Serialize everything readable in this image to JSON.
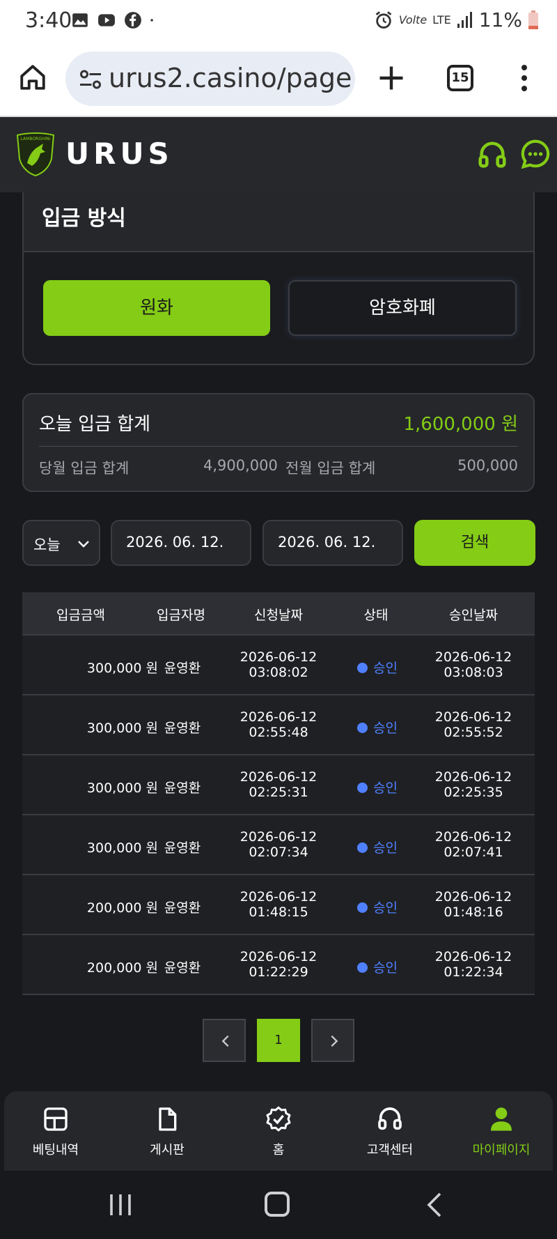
{
  "statusbar": {
    "time": "3:40",
    "battery": "11%",
    "network": "LTE"
  },
  "browser": {
    "url": "urus2.casino/page",
    "tab_count": "15"
  },
  "header": {
    "brand": "URUS",
    "logo_icon": "lamborghini-shield",
    "accent": "#84cc16"
  },
  "method": {
    "title": "입금 방식",
    "krw_label": "원화",
    "crypto_label": "암호화폐"
  },
  "totals": {
    "today_label": "오늘 입금 합계",
    "today_value": "1,600,000 원",
    "month_label": "당월 입금 합계",
    "month_value": "4,900,000",
    "prev_label": "전월 입금 합계",
    "prev_value": "500,000"
  },
  "filters": {
    "period": "오늘",
    "start_date": "2026. 06. 12.",
    "end_date": "2026. 06. 12.",
    "search_label": "검색"
  },
  "table": {
    "headers": [
      "입금금액",
      "입금자명",
      "신청날짜",
      "상태",
      "승인날짜"
    ],
    "rows": [
      {
        "amount": "300,000 원",
        "name": "윤영환",
        "req_date": "2026-06-12",
        "req_time": "03:08:02",
        "status": "승인",
        "appr_date": "2026-06-12",
        "appr_time": "03:08:03"
      },
      {
        "amount": "300,000 원",
        "name": "윤영환",
        "req_date": "2026-06-12",
        "req_time": "02:55:48",
        "status": "승인",
        "appr_date": "2026-06-12",
        "appr_time": "02:55:52"
      },
      {
        "amount": "300,000 원",
        "name": "윤영환",
        "req_date": "2026-06-12",
        "req_time": "02:25:31",
        "status": "승인",
        "appr_date": "2026-06-12",
        "appr_time": "02:25:35"
      },
      {
        "amount": "300,000 원",
        "name": "윤영환",
        "req_date": "2026-06-12",
        "req_time": "02:07:34",
        "status": "승인",
        "appr_date": "2026-06-12",
        "appr_time": "02:07:41"
      },
      {
        "amount": "200,000 원",
        "name": "윤영환",
        "req_date": "2026-06-12",
        "req_time": "01:48:15",
        "status": "승인",
        "appr_date": "2026-06-12",
        "appr_time": "01:48:16"
      },
      {
        "amount": "200,000 원",
        "name": "윤영환",
        "req_date": "2026-06-12",
        "req_time": "01:22:29",
        "status": "승인",
        "appr_date": "2026-06-12",
        "appr_time": "01:22:34"
      }
    ]
  },
  "pager": {
    "current": "1"
  },
  "bottomnav": {
    "items": [
      {
        "label": "베팅내역",
        "icon": "grid-icon"
      },
      {
        "label": "게시판",
        "icon": "document-icon"
      },
      {
        "label": "홈",
        "icon": "badge-check-icon"
      },
      {
        "label": "고객센터",
        "icon": "headset-icon"
      },
      {
        "label": "마이페이지",
        "icon": "user-icon"
      }
    ]
  }
}
